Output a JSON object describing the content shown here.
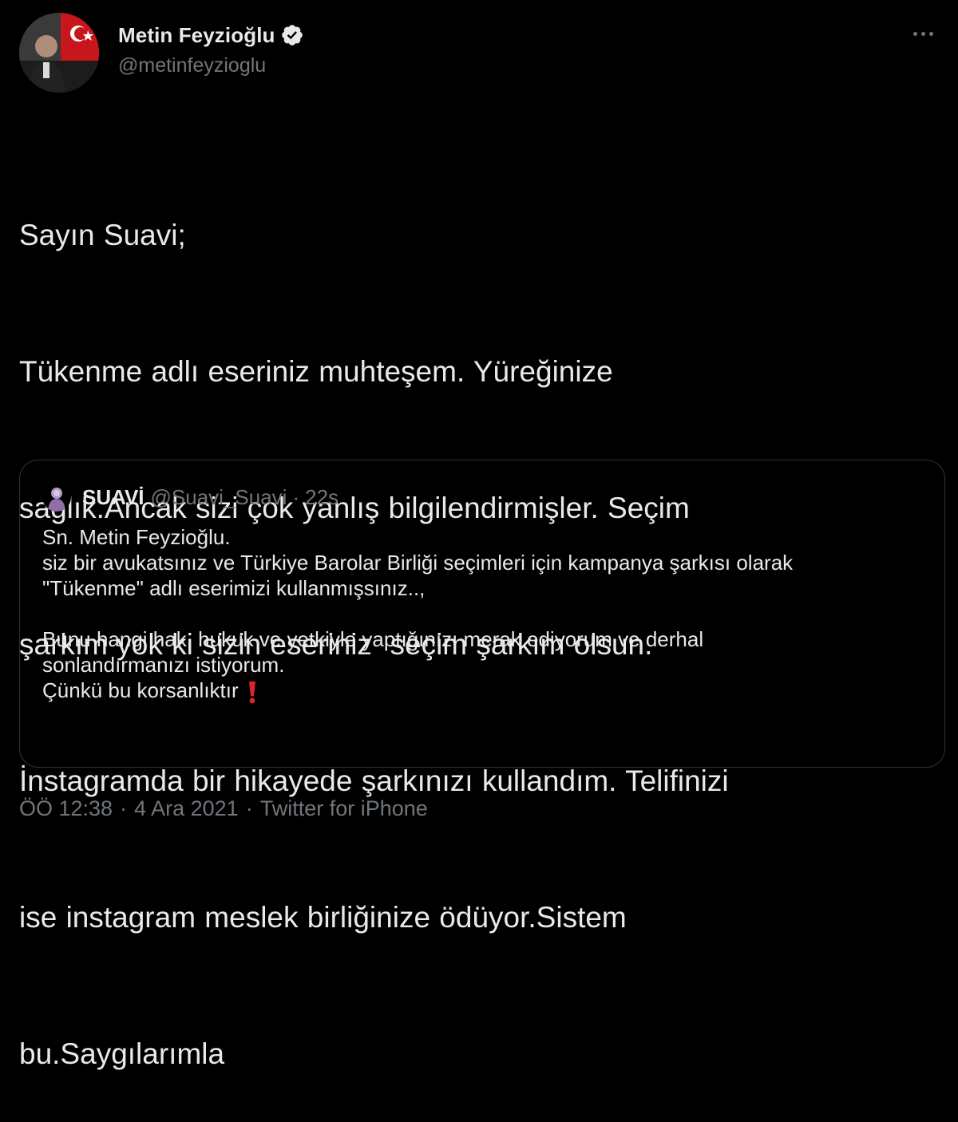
{
  "author": {
    "display_name": "Metin Feyzioğlu",
    "handle": "@metinfeyzioglu",
    "verified": true
  },
  "tweet": {
    "lines": [
      "Sayın Suavi;",
      "Tükenme adlı eseriniz muhteşem. Yüreğinize",
      "sağlık.Ancak sizi çok yanlış bilgilendirmişler. Seçim",
      "şarkım yok ki sizin eseriniz  seçim şarkım olsun.",
      "İnstagramda bir hikayede şarkınızı kullandım. Telifinizi",
      "ise instagram meslek birliğinize ödüyor.Sistem",
      "bu.Saygılarımla"
    ]
  },
  "quoted_tweet": {
    "display_name": "SUAVİ",
    "handle": "@Suavi_Suavi",
    "separator": "·",
    "time": "22s",
    "lines": [
      "Sn. Metin Feyzioğlu.",
      "siz bir avukatsınız ve Türkiye Barolar Birliği seçimleri için kampanya şarkısı olarak",
      "\"Tükenme\" adlı eserimizi kullanmışsınız..,",
      "",
      "Bunu hangi hak, hukuk ve yetkiyle yaptığınızı merak ediyorum ve derhal",
      "sonlandırmanızı istiyorum.",
      "Çünkü bu korsanlıktır"
    ],
    "emoji": "red-exclamation-icon"
  },
  "meta": {
    "time": "ÖÖ 12:38",
    "separator": "·",
    "date": "4 Ara 2021",
    "source": "Twitter for iPhone"
  },
  "colors": {
    "background": "#000000",
    "text": "#e7e9ea",
    "secondary": "#71767b",
    "border": "#2f3336",
    "verified": "#e7e9ea",
    "emoji_red": "#e0242e"
  }
}
